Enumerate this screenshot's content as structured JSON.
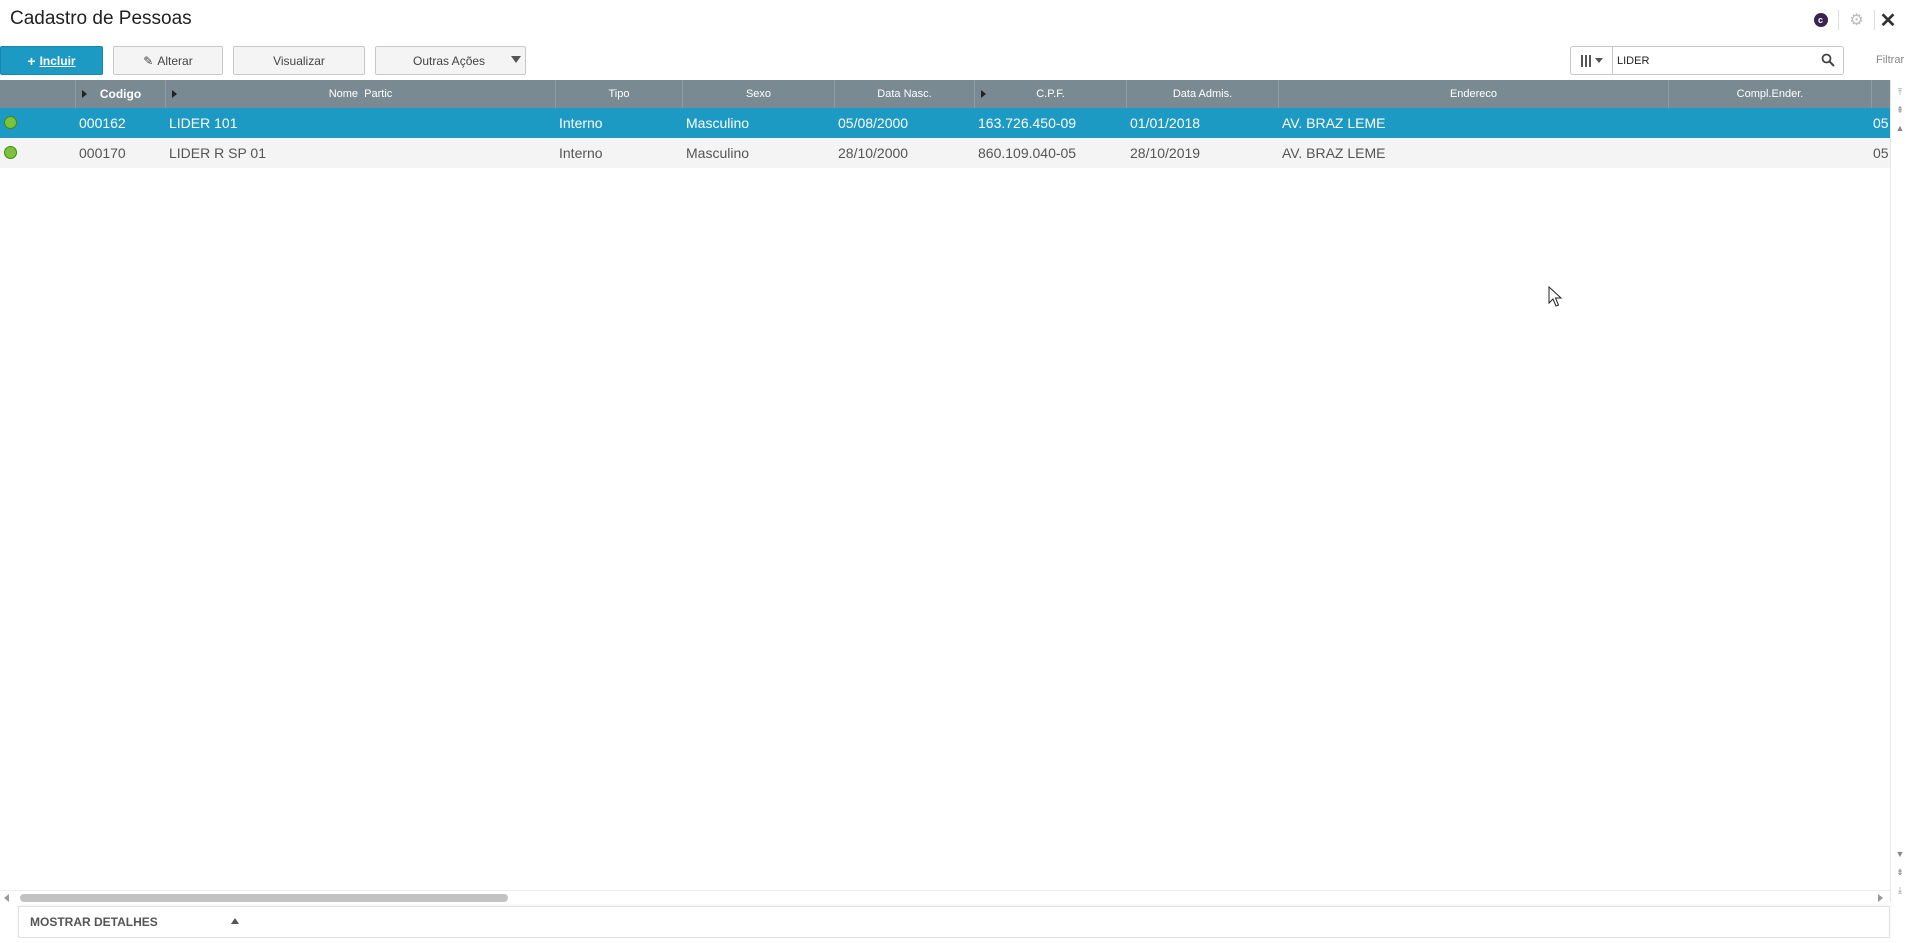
{
  "window": {
    "title": "Cadastro de Pessoas",
    "badge_letter": "c"
  },
  "toolbar": {
    "include_label": "Incluir",
    "alter_label": "Alterar",
    "view_label": "Visualizar",
    "other_actions_label": "Outras Ações",
    "search_value": "LIDER",
    "filter_label": "Filtrar"
  },
  "grid": {
    "columns": [
      {
        "label": ""
      },
      {
        "label": "Codigo"
      },
      {
        "label": "Nome  Partic"
      },
      {
        "label": "Tipo"
      },
      {
        "label": "Sexo"
      },
      {
        "label": "Data Nasc."
      },
      {
        "label": "C.P.F."
      },
      {
        "label": "Data Admis."
      },
      {
        "label": "Endereco"
      },
      {
        "label": "Compl.Ender."
      }
    ],
    "rows": [
      {
        "status": "active",
        "codigo": "000162",
        "nome": "LIDER 101",
        "tipo": "Interno",
        "sexo": "Masculino",
        "data_nasc": "05/08/2000",
        "cpf": "163.726.450-09",
        "data_admis": "01/01/2018",
        "endereco": "AV. BRAZ LEME",
        "overflow": "05"
      },
      {
        "status": "active",
        "codigo": "000170",
        "nome": "LIDER R SP 01",
        "tipo": "Interno",
        "sexo": "Masculino",
        "data_nasc": "28/10/2000",
        "cpf": "860.109.040-05",
        "data_admis": "28/10/2019",
        "endereco": "AV. BRAZ LEME",
        "overflow": "05"
      }
    ]
  },
  "footer": {
    "show_details_label": "MOSTRAR DETALHES"
  },
  "colors": {
    "accent": "#1c9ac4",
    "header_bg": "#7a8a92",
    "status_green": "#7cc23a"
  }
}
